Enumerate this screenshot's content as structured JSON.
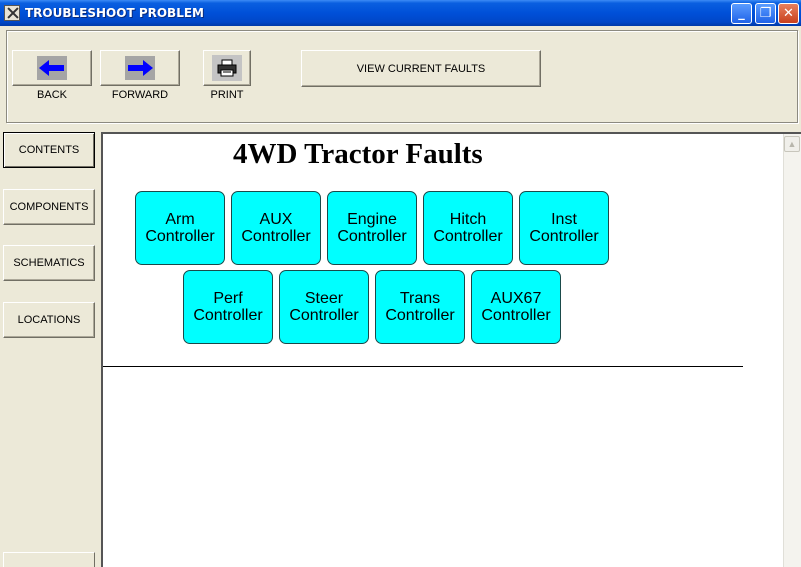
{
  "window": {
    "title": "TROUBLESHOOT PROBLEM",
    "buttons": {
      "minimize": "_",
      "restore": "❐",
      "close": "✕"
    }
  },
  "toolbar": {
    "back_label": "BACK",
    "forward_label": "FORWARD",
    "print_label": "PRINT",
    "view_faults_label": "VIEW CURRENT FAULTS"
  },
  "sidebar": {
    "items": [
      {
        "label": "CONTENTS",
        "active": true
      },
      {
        "label": "COMPONENTS",
        "active": false
      },
      {
        "label": "SCHEMATICS",
        "active": false
      },
      {
        "label": "LOCATIONS",
        "active": false
      }
    ]
  },
  "main": {
    "title": "4WD Tractor Faults",
    "controllers": [
      {
        "line1": "Arm",
        "line2": "Controller"
      },
      {
        "line1": "AUX",
        "line2": "Controller"
      },
      {
        "line1": "Engine",
        "line2": "Controller"
      },
      {
        "line1": "Hitch",
        "line2": "Controller"
      },
      {
        "line1": "Inst",
        "line2": "Controller"
      },
      {
        "line1": "Perf",
        "line2": "Controller"
      },
      {
        "line1": "Steer",
        "line2": "Controller"
      },
      {
        "line1": "Trans",
        "line2": "Controller"
      },
      {
        "line1": "AUX67",
        "line2": "Controller"
      }
    ]
  },
  "colors": {
    "titlebar": "#0050d8",
    "controller_fill": "#00ffff",
    "arrow_blue": "#0000ff",
    "face": "#ece9d8"
  },
  "icons": {
    "back": "left-arrow-icon",
    "forward": "right-arrow-icon",
    "print": "printer-icon"
  }
}
